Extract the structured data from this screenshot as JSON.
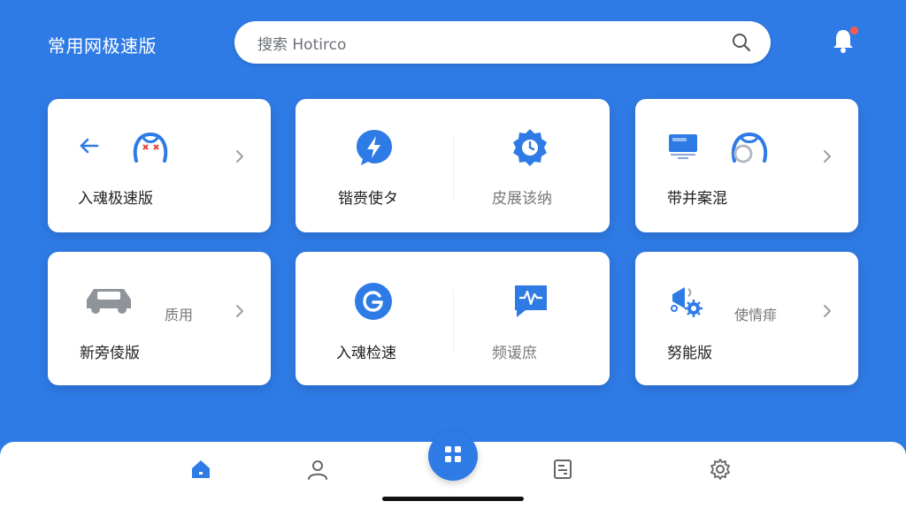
{
  "header": {
    "app_title": "常用网极速版",
    "search_text": "搜索 Hotirco",
    "has_notification": true
  },
  "cards": [
    {
      "label": "入魂极速版"
    },
    {
      "left_label": "锴赍使タ",
      "right_label": "皮展该纳"
    },
    {
      "label": "带并案混"
    },
    {
      "label": "新旁倰版",
      "side_label": "质用"
    },
    {
      "left_label": "入魂检速",
      "right_label": "频谖庶"
    },
    {
      "label": "努能版",
      "side_label": "使情痱"
    }
  ],
  "colors": {
    "primary": "#2f7be6",
    "notification": "#ff5a4a",
    "icon_red": "#e8463b",
    "card_bg": "#ffffff"
  },
  "icons": {
    "search": "search-icon",
    "bell": "bell-icon",
    "bottom_tabs": [
      "home-icon",
      "user-icon",
      "apps-icon",
      "document-icon",
      "settings-icon"
    ]
  }
}
